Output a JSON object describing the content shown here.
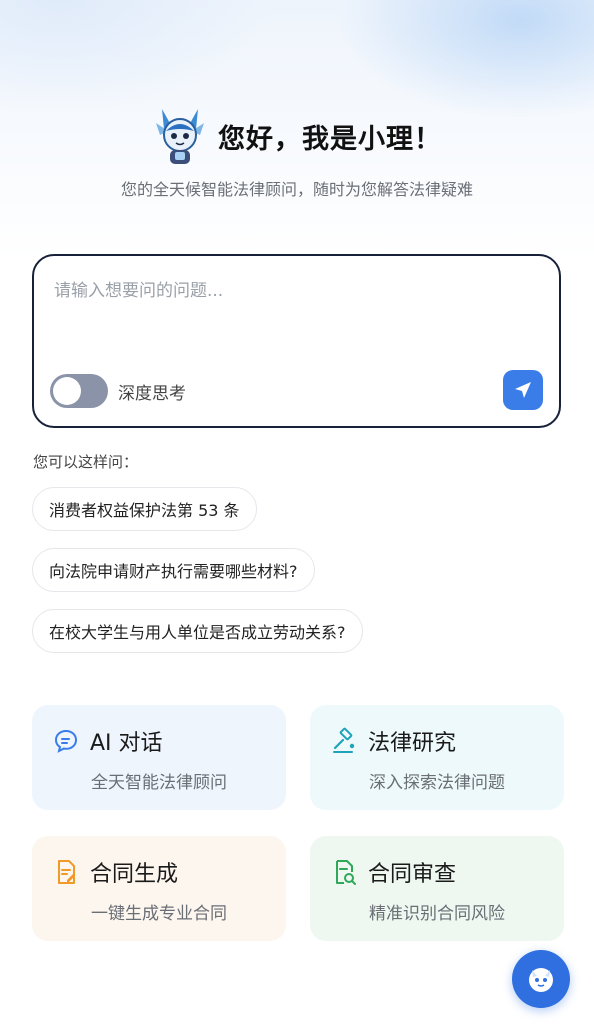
{
  "header": {
    "greeting": "您好，我是小理！",
    "subtitle": "您的全天候智能法律顾问，随时为您解答法律疑难"
  },
  "input": {
    "placeholder": "请输入想要问的问题...",
    "deep_think_label": "深度思考",
    "deep_think_on": false
  },
  "suggestions": {
    "title": "您可以这样问：",
    "items": [
      "消费者权益保护法第 53 条",
      "向法院申请财产执行需要哪些材料?",
      "在校大学生与用人单位是否成立劳动关系?"
    ]
  },
  "features": [
    {
      "title": "AI 对话",
      "desc": "全天智能法律顾问",
      "icon": "chat-icon",
      "color": "#3a7de8"
    },
    {
      "title": "法律研究",
      "desc": "深入探索法律问题",
      "icon": "gavel-icon",
      "color": "#1fa3b8"
    },
    {
      "title": "合同生成",
      "desc": "一键生成专业合同",
      "icon": "document-edit-icon",
      "color": "#f09a2a"
    },
    {
      "title": "合同审查",
      "desc": "精准识别合同风险",
      "icon": "document-search-icon",
      "color": "#2fa85a"
    }
  ],
  "colors": {
    "accent": "#3a7de8",
    "card_blue": "#eef5fd",
    "card_cyan": "#eef9fb",
    "card_orange": "#fdf6ef",
    "card_green": "#eef8f0"
  }
}
